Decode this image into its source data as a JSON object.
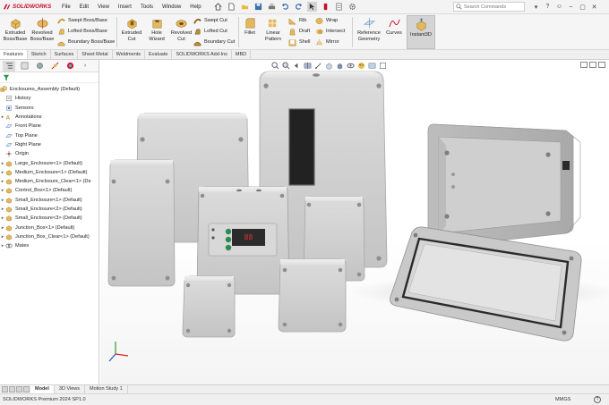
{
  "app": {
    "logo_text": "SOLIDWORKS",
    "brand_color": "#c8102e"
  },
  "menu": [
    "File",
    "Edit",
    "View",
    "Insert",
    "Tools",
    "Window",
    "Help"
  ],
  "search": {
    "placeholder": "Search Commands"
  },
  "ribbon": {
    "extruded_boss": "Extruded\nBoss/Base",
    "revolved_boss": "Revolved\nBoss/Base",
    "swept_boss": "Swept Boss/Base",
    "lofted_boss": "Lofted Boss/Base",
    "boundary_boss": "Boundary Boss/Base",
    "extruded_cut": "Extruded\nCut",
    "hole_wizard": "Hole\nWizard",
    "revolved_cut": "Revolved\nCut",
    "swept_cut": "Swept Cut",
    "lofted_cut": "Lofted Cut",
    "boundary_cut": "Boundary Cut",
    "fillet": "Fillet",
    "linear_pattern": "Linear\nPattern",
    "rib": "Rib",
    "draft": "Draft",
    "shell": "Shell",
    "wrap": "Wrap",
    "intersect": "Intersect",
    "mirror": "Mirror",
    "reference_geometry": "Reference\nGeometry",
    "curves": "Curves",
    "instant3d": "Instant3D"
  },
  "tabs": [
    "Features",
    "Sketch",
    "Surfaces",
    "Sheet Metal",
    "Weldments",
    "Evaluate",
    "SOLIDWORKS Add-Ins",
    "MBD"
  ],
  "active_tab": "Features",
  "tree": {
    "root": "Enclosures_Assembly  (Default)",
    "items": [
      "History",
      "Sensors",
      "Annotations",
      "Front Plane",
      "Top Plane",
      "Right Plane",
      "Origin",
      "Large_Enclosure<1> (Default)",
      "Medium_Enclosure<1> (Default)",
      "Medium_Enclosure_Clear<1> (De",
      "Control_Box<1> (Default)",
      "Small_Enclosure<1> (Default)",
      "Small_Enclosure<2> (Default)",
      "Small_Enclosure<3> (Default)",
      "Junction_Box<1> (Default)",
      "Junction_Box_Clear<1> (Default)",
      "Mates"
    ]
  },
  "bottom_tabs": [
    "Model",
    "3D Views",
    "Motion Study 1"
  ],
  "active_bottom_tab": "Model",
  "status": {
    "product": "SOLIDWORKS Premium 2024 SP1.0",
    "units": "MMGS",
    "help": "?"
  },
  "control_box_display": "88"
}
